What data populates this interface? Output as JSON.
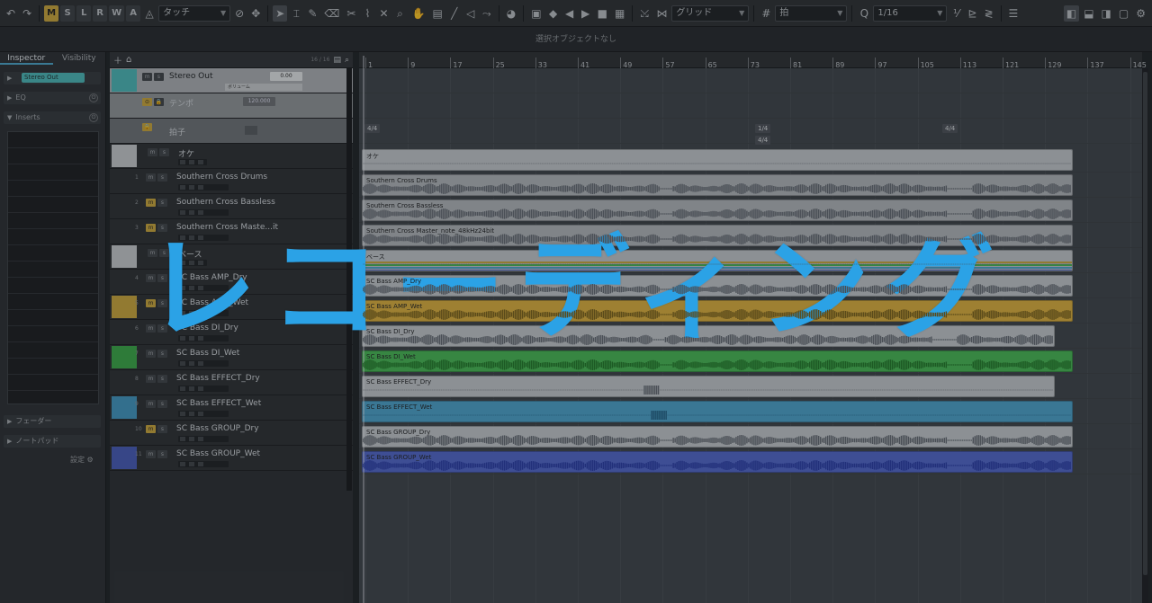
{
  "toolbar": {
    "mode_buttons": [
      "M",
      "S",
      "L",
      "R",
      "W",
      "A"
    ],
    "automation_mode": "タッチ",
    "snap_type": "グリッド",
    "grid_type": "拍",
    "quantize": "1/16"
  },
  "info_line": "選択オブジェクトなし",
  "inspector": {
    "tabs": [
      "Inspector",
      "Visibility"
    ],
    "channel_name": "Stereo Out",
    "sections": [
      "EQ",
      "Inserts"
    ],
    "bottom_sections": [
      "フェーダー",
      "ノートパッド"
    ],
    "settings_label": "設定"
  },
  "tracklist": {
    "track_count": "16 / 16",
    "stereo_out": {
      "name": "Stereo Out",
      "value": "0.00",
      "volume_label": "ボリューム"
    },
    "tempo": {
      "name": "テンポ",
      "value": "120.000"
    },
    "signature": {
      "name": "拍子"
    },
    "tracks": [
      {
        "num": "",
        "name": "オケ",
        "color": "#c3c6c9",
        "folder": true,
        "mute_on": false
      },
      {
        "num": "1",
        "name": "Southern Cross Drums",
        "color": "#2b2e32",
        "folder": false,
        "mute_on": false
      },
      {
        "num": "2",
        "name": "Southern Cross Bassless",
        "color": "#2b2e32",
        "folder": false,
        "mute_on": true
      },
      {
        "num": "3",
        "name": "Southern Cross Maste...it",
        "color": "#2b2e32",
        "folder": false,
        "mute_on": true
      },
      {
        "num": "",
        "name": "ベース",
        "color": "#c3c6c9",
        "folder": true,
        "mute_on": false
      },
      {
        "num": "4",
        "name": "SC Bass AMP_Dry",
        "color": "#2b2e32",
        "folder": false,
        "mute_on": false
      },
      {
        "num": "5",
        "name": "SC Bass AMP_Wet",
        "color": "#c8a43a",
        "folder": false,
        "mute_on": true
      },
      {
        "num": "6",
        "name": "SC Bass DI_Dry",
        "color": "#2b2e32",
        "folder": false,
        "mute_on": false
      },
      {
        "num": "7",
        "name": "SC Bass DI_Wet",
        "color": "#39a545",
        "folder": false,
        "mute_on": false
      },
      {
        "num": "8",
        "name": "SC Bass EFFECT_Dry",
        "color": "#2b2e32",
        "folder": false,
        "mute_on": false
      },
      {
        "num": "9",
        "name": "SC Bass EFFECT_Wet",
        "color": "#3f94bd",
        "folder": false,
        "mute_on": false
      },
      {
        "num": "10",
        "name": "SC Bass GROUP_Dry",
        "color": "#2b2e32",
        "folder": false,
        "mute_on": true
      },
      {
        "num": "11",
        "name": "SC Bass GROUP_Wet",
        "color": "#4659b5",
        "folder": false,
        "mute_on": false
      }
    ]
  },
  "ruler": {
    "bars": [
      "1",
      "9",
      "17",
      "25",
      "33",
      "41",
      "49",
      "57",
      "65",
      "73",
      "81",
      "89",
      "97",
      "105",
      "113",
      "121",
      "129",
      "137",
      "145"
    ]
  },
  "signature_markers": [
    "4/4",
    "1/4",
    "4/4",
    "4/4"
  ],
  "clips": [
    {
      "name": "オケ",
      "color": "#bfc3c7"
    },
    {
      "name": "Southern Cross Drums",
      "color": "#aeb2b6"
    },
    {
      "name": "Southern Cross Bassless",
      "color": "#aeb2b6"
    },
    {
      "name": "Southern Cross Master_note_48kHz24bit",
      "color": "#aeb2b6"
    },
    {
      "name": "ベース",
      "color": "#bfc3c7"
    },
    {
      "name": "SC Bass AMP_Dry",
      "color": "#bfc3c7"
    },
    {
      "name": "SC Bass AMP_Wet",
      "color": "#d9ad3c"
    },
    {
      "name": "SC Bass DI_Dry",
      "color": "#bfc3c7"
    },
    {
      "name": "SC Bass DI_Wet",
      "color": "#45b552"
    },
    {
      "name": "SC Bass EFFECT_Dry",
      "color": "#bfc3c7"
    },
    {
      "name": "SC Bass EFFECT_Wet",
      "color": "#4aa0c8"
    },
    {
      "name": "SC Bass GROUP_Dry",
      "color": "#bfc3c7"
    },
    {
      "name": "SC Bass GROUP_Wet",
      "color": "#5065c8"
    }
  ],
  "banner_text": "レコーディング"
}
